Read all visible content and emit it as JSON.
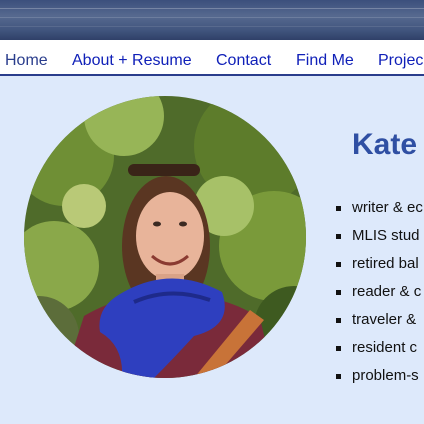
{
  "nav": {
    "items": [
      {
        "label": "Home",
        "active": true
      },
      {
        "label": "About + Resume",
        "active": false
      },
      {
        "label": "Contact",
        "active": false
      },
      {
        "label": "Find Me",
        "active": false
      },
      {
        "label": "Projec",
        "active": false
      }
    ]
  },
  "profile": {
    "name": "Kate",
    "bio_items": [
      "writer & ec",
      "MLIS stud",
      "retired bal",
      "reader & c",
      "traveler &",
      "resident c",
      "problem-s"
    ]
  },
  "colors": {
    "page_background": "#dde9fb",
    "nav_link": "#1020b8",
    "nav_border": "#2a3d8c",
    "name": "#2f4fa3"
  }
}
